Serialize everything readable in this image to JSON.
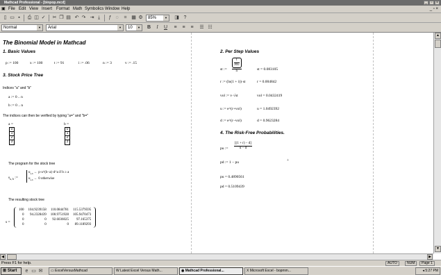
{
  "window": {
    "title": "Mathcad Professional - [binpop.mcd]"
  },
  "menu": [
    "File",
    "Edit",
    "View",
    "Insert",
    "Format",
    "Math",
    "Symbolics",
    "Window",
    "Help"
  ],
  "toolbar": {
    "zoom": "85%"
  },
  "format": {
    "style": "Normal",
    "font": "Arial",
    "size": "10"
  },
  "doc": {
    "title": "The Binomial Model in Mathcad",
    "s1": "1. Basic Values",
    "basics": [
      "p := 100",
      "x := 100",
      "t := 91",
      "i := .06",
      "n := 3",
      "v := .15"
    ],
    "s3": "3. Stock Price Tree",
    "indices": "Indices \"a\" and \"b\"",
    "a_def": "a := 0 .. n",
    "b_def": "b := 0 .. n",
    "verify": "The indices can then be verified by typing \"a=\" and \"b=\"",
    "a_eq": "a =",
    "b_eq": "b =",
    "a_vals": [
      "0",
      "1",
      "2",
      "3"
    ],
    "b_vals": [
      "0",
      "1",
      "2",
      "3"
    ],
    "program": "The program for the stock tree",
    "prog_lhs": "s",
    "prog_sub": "a, b",
    "prog_l1": "u",
    "prog_l1b": "← p·u^(b−a)·d^a  if  b ≥ a",
    "prog_l2": "u",
    "prog_l2b": "← 0  otherwise",
    "result": "The resulting stock tree",
    "matrix_lhs": "s =",
    "matrix": [
      [
        "100",
        "104.9239158",
        "110.0844781",
        "115.5379595"
      ],
      [
        "0",
        "94.2328439",
        "100.9751928",
        "105.9470473"
      ],
      [
        "0",
        "0",
        "92.6036025",
        "97.165375"
      ],
      [
        "0",
        "0",
        "0",
        "89.1189293"
      ]
    ],
    "s2": "2. Per Step Values",
    "st_lhs": "st :=",
    "st_num": "t",
    "st_den": "365",
    "st_over": "n",
    "st_val": "st = 0.083105",
    "r_def": "r := (ln(1 + i))·st",
    "r_val": "r = 0.004842",
    "vol_def": "vol := v·√st",
    "vol_val": "vol = 0.0432419",
    "u_def": "u := e^(r+vol)",
    "u_val": "u = 1.0492392",
    "d_def": "d := e^(r−vol)",
    "d_val": "d = 0.9623284",
    "s4": "4. The Risk-Free Probabilities.",
    "pu_lhs": "pu :=",
    "pu_num": "[(1 + r) − d]",
    "pu_den": "u − d",
    "pd_def": "pd := 1 − pu",
    "pu_val": "pu = 0.4890561",
    "pd_val": "pd = 0.5109439"
  },
  "status": {
    "help": "Press F1 for help.",
    "auto": "AUTO",
    "num": "NUM",
    "page": "Page 1"
  },
  "taskbar": {
    "start": "Start",
    "tasks": [
      "ExcelVersusMathcad",
      "Latest Excel Versus Math...",
      "Mathcad Professional...",
      "Microsoft Excel - bopmm..."
    ],
    "clock": "5:27 PM"
  }
}
